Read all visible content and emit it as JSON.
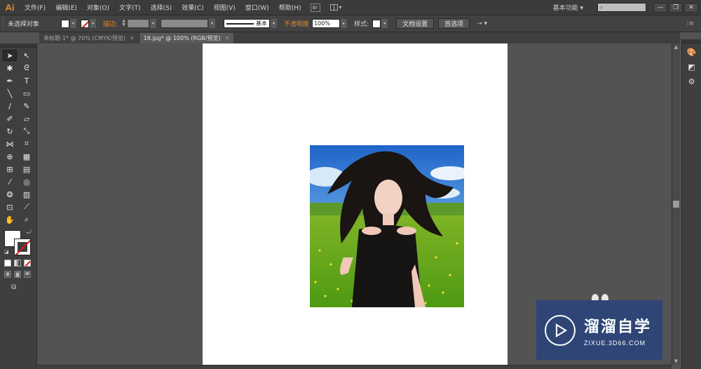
{
  "app": {
    "logo": "Ai"
  },
  "menu": [
    "文件(F)",
    "编辑(E)",
    "对象(O)",
    "文字(T)",
    "选择(S)",
    "效果(C)",
    "视图(V)",
    "窗口(W)",
    "帮助(H)"
  ],
  "bridge_label": "Br",
  "workspace_label": "基本功能",
  "window_controls": {
    "minimize": "—",
    "restore": "❐",
    "close": "✕"
  },
  "control_bar": {
    "selection_label": "未选择对象",
    "stroke_label": "描边:",
    "stroke_style_label": "基本",
    "opacity_label": "不透明度",
    "opacity_value": "100%",
    "style_label": "样式:",
    "doc_setup_button": "文档设置",
    "preferences_button": "首选项"
  },
  "tabs": [
    {
      "label": "未标题-1* @ 70% (CMYK/预览)",
      "active": false
    },
    {
      "label": "18.jpg* @ 100% (RGB/预览)",
      "active": true
    }
  ],
  "tools": [
    {
      "name": "selection-tool",
      "icon": "➤",
      "selected": true
    },
    {
      "name": "direct-selection-tool",
      "icon": "↖",
      "selected": false
    },
    {
      "name": "magic-wand-tool",
      "icon": "✱",
      "selected": false
    },
    {
      "name": "lasso-tool",
      "icon": "ᘓ",
      "selected": false
    },
    {
      "name": "pen-tool",
      "icon": "✒",
      "selected": false
    },
    {
      "name": "type-tool",
      "icon": "T",
      "selected": false
    },
    {
      "name": "line-tool",
      "icon": "╲",
      "selected": false
    },
    {
      "name": "rectangle-tool",
      "icon": "▭",
      "selected": false
    },
    {
      "name": "paintbrush-tool",
      "icon": "∕",
      "selected": false
    },
    {
      "name": "pencil-tool",
      "icon": "✎",
      "selected": false
    },
    {
      "name": "blob-brush-tool",
      "icon": "✐",
      "selected": false
    },
    {
      "name": "eraser-tool",
      "icon": "▱",
      "selected": false
    },
    {
      "name": "rotate-tool",
      "icon": "↻",
      "selected": false
    },
    {
      "name": "scale-tool",
      "icon": "⤡",
      "selected": false
    },
    {
      "name": "width-tool",
      "icon": "⋈",
      "selected": false
    },
    {
      "name": "free-transform-tool",
      "icon": "⌗",
      "selected": false
    },
    {
      "name": "shape-builder-tool",
      "icon": "⊕",
      "selected": false
    },
    {
      "name": "perspective-grid-tool",
      "icon": "▦",
      "selected": false
    },
    {
      "name": "mesh-tool",
      "icon": "⊞",
      "selected": false
    },
    {
      "name": "gradient-tool",
      "icon": "▤",
      "selected": false
    },
    {
      "name": "eyedropper-tool",
      "icon": "⁄",
      "selected": false
    },
    {
      "name": "blend-tool",
      "icon": "◎",
      "selected": false
    },
    {
      "name": "symbol-sprayer-tool",
      "icon": "❂",
      "selected": false
    },
    {
      "name": "column-graph-tool",
      "icon": "▥",
      "selected": false
    },
    {
      "name": "artboard-tool",
      "icon": "⊡",
      "selected": false
    },
    {
      "name": "slice-tool",
      "icon": "⟋",
      "selected": false
    },
    {
      "name": "hand-tool",
      "icon": "✋",
      "selected": false
    },
    {
      "name": "zoom-tool",
      "icon": "⌕",
      "selected": false
    }
  ],
  "watermark": {
    "title": "溜溜自学",
    "url": "ZIXUE.3D66.COM"
  }
}
